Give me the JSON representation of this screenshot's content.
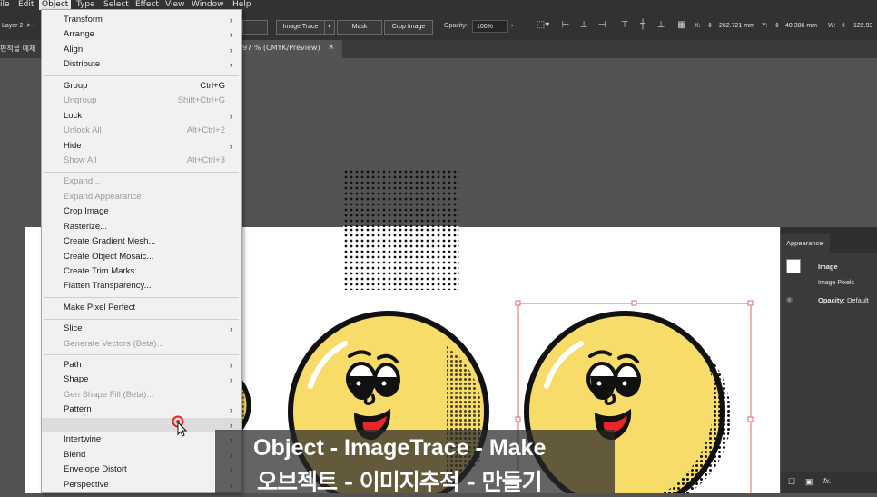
{
  "menubar": {
    "items": [
      "ile",
      "Edit",
      "Object",
      "Type",
      "Select",
      "Effect",
      "View",
      "Window",
      "Help"
    ],
    "active": "Object"
  },
  "control_bar": {
    "layer_label": "Layer 2 -> ·",
    "image_trace_label": "Image Trace",
    "mask_label": "Mask",
    "crop_image_label": "Crop Image",
    "opacity_label": "Opacity:",
    "opacity_value": "100%",
    "x_label": "X:",
    "x_value": "262.721 mm",
    "y_label": "Y:",
    "y_value": "40.386 mm",
    "w_label": "W:",
    "w_value": "122.93"
  },
  "tab_bar": {
    "left_text": "편적을 예제",
    "doc_title": "97 % (CMYK/Preview)",
    "close_symbol": "×"
  },
  "object_menu": {
    "items": [
      {
        "label": "Transform",
        "submenu": true,
        "shortcut": "",
        "disabled": false
      },
      {
        "label": "Arrange",
        "submenu": true,
        "shortcut": "",
        "disabled": false
      },
      {
        "label": "Align",
        "submenu": true,
        "shortcut": "",
        "disabled": false
      },
      {
        "label": "Distribute",
        "submenu": true,
        "shortcut": "",
        "disabled": false
      },
      {
        "label": "Group",
        "submenu": false,
        "shortcut": "Ctrl+G",
        "disabled": false
      },
      {
        "label": "Ungroup",
        "submenu": false,
        "shortcut": "Shift+Ctrl+G",
        "disabled": true
      },
      {
        "label": "Lock",
        "submenu": true,
        "shortcut": "",
        "disabled": false
      },
      {
        "label": "Unlock All",
        "submenu": false,
        "shortcut": "Alt+Ctrl+2",
        "disabled": true
      },
      {
        "label": "Hide",
        "submenu": true,
        "shortcut": "",
        "disabled": false
      },
      {
        "label": "Show All",
        "submenu": false,
        "shortcut": "Alt+Ctrl+3",
        "disabled": true
      },
      {
        "label": "Expand...",
        "submenu": false,
        "shortcut": "",
        "disabled": true
      },
      {
        "label": "Expand Appearance",
        "submenu": false,
        "shortcut": "",
        "disabled": true
      },
      {
        "label": "Crop Image",
        "submenu": false,
        "shortcut": "",
        "disabled": false
      },
      {
        "label": "Rasterize...",
        "submenu": false,
        "shortcut": "",
        "disabled": false
      },
      {
        "label": "Create Gradient Mesh...",
        "submenu": false,
        "shortcut": "",
        "disabled": false
      },
      {
        "label": "Create Object Mosaic...",
        "submenu": false,
        "shortcut": "",
        "disabled": false
      },
      {
        "label": "Create Trim Marks",
        "submenu": false,
        "shortcut": "",
        "disabled": false
      },
      {
        "label": "Flatten Transparency...",
        "submenu": false,
        "shortcut": "",
        "disabled": false
      },
      {
        "label": "Make Pixel Perfect",
        "submenu": false,
        "shortcut": "",
        "disabled": false
      },
      {
        "label": "Slice",
        "submenu": true,
        "shortcut": "",
        "disabled": false
      },
      {
        "label": "Generate Vectors (Beta)...",
        "submenu": false,
        "shortcut": "",
        "disabled": true
      },
      {
        "label": "Path",
        "submenu": true,
        "shortcut": "",
        "disabled": false
      },
      {
        "label": "Shape",
        "submenu": true,
        "shortcut": "",
        "disabled": false
      },
      {
        "label": "Gen Shape Fill (Beta)...",
        "submenu": false,
        "shortcut": "",
        "disabled": true
      },
      {
        "label": "Pattern",
        "submenu": true,
        "shortcut": "",
        "disabled": false
      },
      {
        "label": "",
        "submenu": true,
        "shortcut": "",
        "disabled": false
      },
      {
        "label": "Intertwine",
        "submenu": true,
        "shortcut": "",
        "disabled": false
      },
      {
        "label": "Blend",
        "submenu": true,
        "shortcut": "",
        "disabled": false
      },
      {
        "label": "Envelope Distort",
        "submenu": true,
        "shortcut": "",
        "disabled": false
      },
      {
        "label": "Perspective",
        "submenu": true,
        "shortcut": "",
        "disabled": false
      }
    ]
  },
  "appearance_panel": {
    "tab_label": "Appearance",
    "object_label": "Image",
    "sub_label": "Image Pixels",
    "opacity_label": "Opacity:",
    "opacity_value": "Default",
    "fx_label": "fx."
  },
  "caption": {
    "line1": "Object - ImageTrace - Make",
    "line2": "오브젝트 - 이미지추적 - 만들기"
  },
  "colors": {
    "ui_dark": "#323232",
    "canvas_bg": "#535353",
    "menu_bg": "#f1f1f1",
    "face_yellow": "#f7dc6a",
    "mouth_red": "#e8262a",
    "selection_red": "#e26a6a"
  }
}
